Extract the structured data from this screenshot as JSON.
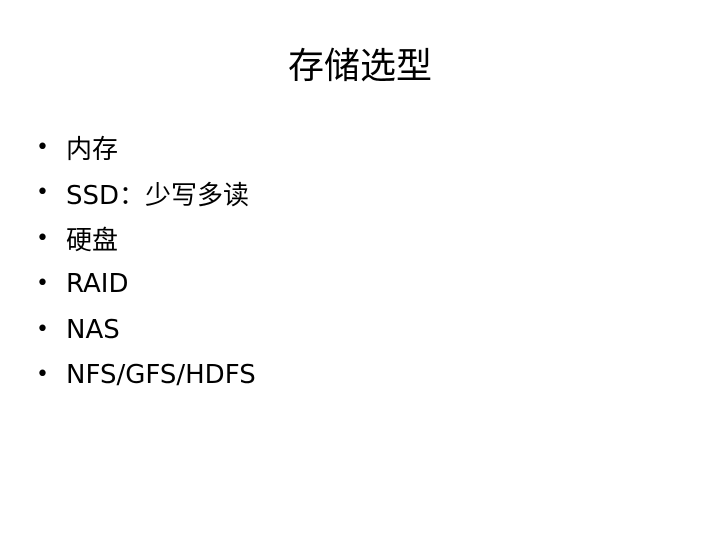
{
  "slide": {
    "title": "存储选型",
    "bullet_symbol": "•",
    "items": [
      "内存",
      "SSD：少写多读",
      "硬盘",
      "RAID",
      "NAS",
      "NFS/GFS/HDFS"
    ]
  }
}
